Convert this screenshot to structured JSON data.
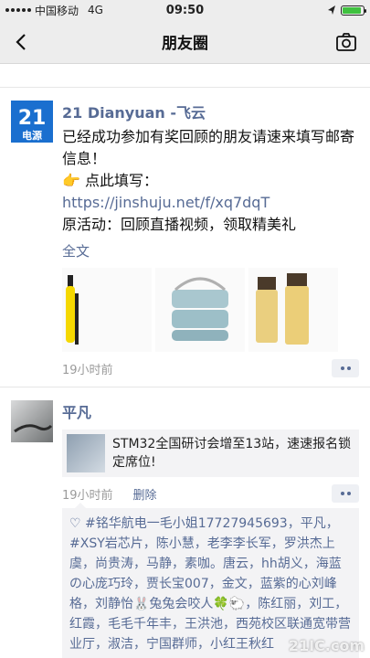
{
  "status": {
    "carrier": "中国移动",
    "network": "4G",
    "time": "09:50",
    "battery_level": 0.9
  },
  "nav": {
    "title": "朋友圈"
  },
  "post1": {
    "author": "21 Dianyuan -飞云",
    "avatar_text": "21",
    "avatar_sub": "电源",
    "line1": "已经成功参加有奖回顾的朋友请速来填写邮寄信息！",
    "line2": "👉 点此填写：",
    "link": "https://jinshuju.net/f/xq7dqT",
    "line3": "原活动：回顾直播视频，领取精美礼",
    "fulltext": "全文",
    "images": [
      "yellow-thermos",
      "lunch-box",
      "glass-bottles"
    ],
    "time": "19小时前"
  },
  "post2": {
    "author": "平凡",
    "share_text": "STM32全国研讨会增至13站，速速报名锁定席位!",
    "time": "19小时前",
    "delete_label": "删除",
    "likes": "♡ #铭华航电一毛小姐17727945693，平凡，#XSY岩芯片，陈小慧，老李李长军，罗洪杰上虞，尚贵涛，马静，素咖。唐云，hh胡义，海蓝の心庞巧玲，贾长宝007，金文，蓝紫的心刘峰格，刘静怡🐰兔兔会咬人🍀🐑，陈红丽，刘工，红霞，毛毛千年丰，王洪池，西苑校区联通宽带营业厅，淑洁，宁国群师，小红王秋红"
  },
  "watermark": "21IC.com",
  "colors": {
    "link": "#576b95",
    "bg": "#f7f7f7",
    "bar": "#ededed"
  }
}
